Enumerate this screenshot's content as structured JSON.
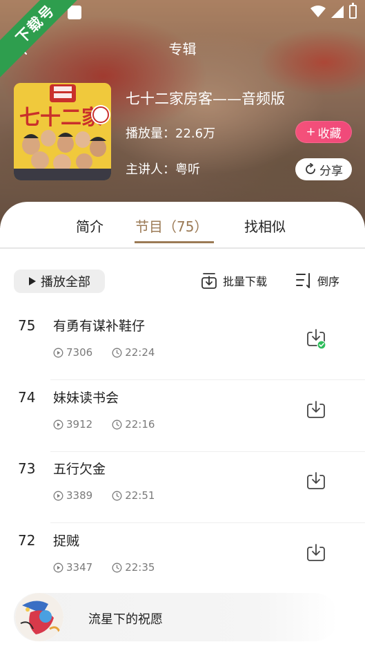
{
  "nav": {
    "title": "专辑"
  },
  "watermark": {
    "text": "下载号"
  },
  "album": {
    "title": "七十二家房客——音频版",
    "plays": "播放量：22.6万",
    "speaker": "主讲人：粤听",
    "cover_text": "七十二家"
  },
  "actions": {
    "collect_label": "收藏",
    "collect_plus": "+",
    "share_label": "分享"
  },
  "tabs": [
    {
      "label": "简介"
    },
    {
      "label": "节目（75）"
    },
    {
      "label": "找相似"
    }
  ],
  "toolbar": {
    "play_all": "播放全部",
    "batch_download": "批量下载",
    "reverse": "倒序"
  },
  "episodes": [
    {
      "num": "75",
      "title": "有勇有谋补鞋仔",
      "plays": "7306",
      "duration": "22:24",
      "downloaded": true
    },
    {
      "num": "74",
      "title": "妹妹读书会",
      "plays": "3912",
      "duration": "22:16",
      "downloaded": false
    },
    {
      "num": "73",
      "title": "五行欠金",
      "plays": "3389",
      "duration": "22:51",
      "downloaded": false
    },
    {
      "num": "72",
      "title": "捉贼",
      "plays": "3347",
      "duration": "22:35",
      "downloaded": false
    }
  ],
  "player": {
    "title": "流星下的祝愿"
  },
  "colors": {
    "accent": "#9b7a55",
    "collect": "#f0497a",
    "downloaded_check": "#2ebd5b"
  }
}
